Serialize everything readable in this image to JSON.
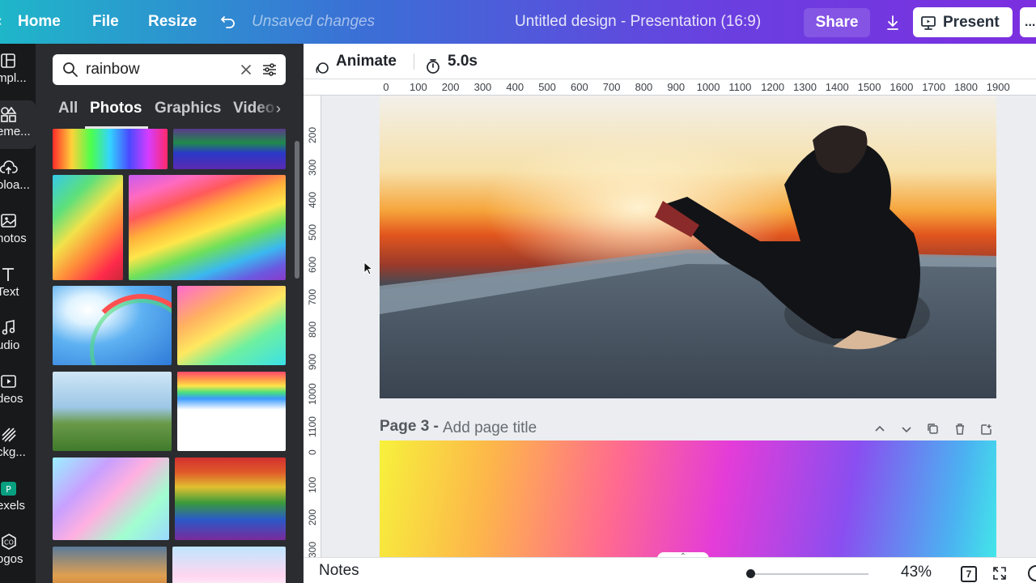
{
  "topbar": {
    "home": "Home",
    "file": "File",
    "resize": "Resize",
    "undo_icon": "undo-icon",
    "unsaved": "Unsaved changes",
    "doc_title": "Untitled design - Presentation (16:9)",
    "share": "Share",
    "download_icon": "download-icon",
    "present": "Present",
    "more": "..."
  },
  "rail": {
    "items": [
      {
        "label": "mpl...",
        "icon": "templates-icon"
      },
      {
        "label": "eme...",
        "icon": "elements-icon"
      },
      {
        "label": "oloa...",
        "icon": "uploads-icon"
      },
      {
        "label": "hotos",
        "icon": "photos-icon"
      },
      {
        "label": "Text",
        "icon": "text-icon"
      },
      {
        "label": "udio",
        "icon": "audio-icon"
      },
      {
        "label": "deos",
        "icon": "videos-icon"
      },
      {
        "label": "ckg...",
        "icon": "background-icon"
      },
      {
        "label": "exels",
        "icon": "pexels-icon"
      },
      {
        "label": "ogos",
        "icon": "logos-icon"
      }
    ]
  },
  "panel": {
    "search_value": "rainbow",
    "tabs": [
      "All",
      "Photos",
      "Graphics",
      "Videos"
    ],
    "active_tab": "Photos"
  },
  "editor": {
    "animate": "Animate",
    "duration": "5.0s"
  },
  "ruler": {
    "h_labels": [
      "0",
      "100",
      "200",
      "300",
      "400",
      "500",
      "600",
      "700",
      "800",
      "900",
      "1000",
      "1100",
      "1200",
      "1300",
      "1400",
      "1500",
      "1600",
      "1700",
      "1800",
      "1900"
    ],
    "v_labels_top": [
      "200",
      "300",
      "400",
      "500",
      "600",
      "700",
      "800",
      "900",
      "1000",
      "1100"
    ],
    "v_labels_bottom": [
      "0",
      "100",
      "200",
      "300"
    ]
  },
  "page3": {
    "number": "Page 3 -",
    "title_placeholder": "Add page title"
  },
  "bottombar": {
    "notes": "Notes",
    "zoom": "43%",
    "pages": "7"
  },
  "colors": {
    "accent_gradient_start": "#1fb6c9",
    "accent_gradient_end": "#7c2fe0",
    "panel_bg": "#2a2c30",
    "rail_bg": "#18191b"
  }
}
